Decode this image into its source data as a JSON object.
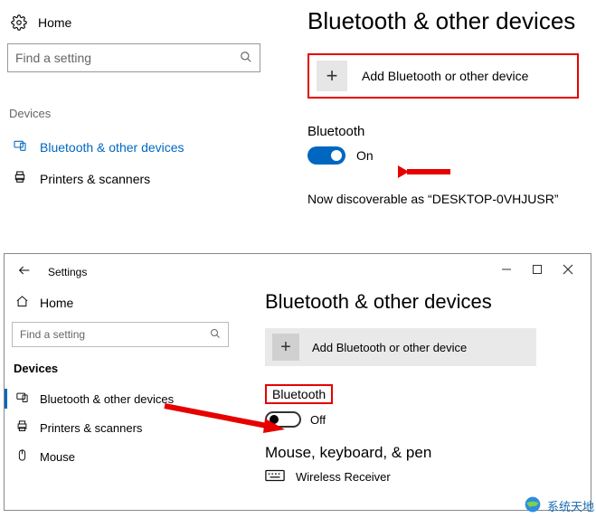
{
  "top": {
    "home_label": "Home",
    "search_placeholder": "Find a setting",
    "section_label": "Devices",
    "nav": [
      {
        "label": "Bluetooth & other devices",
        "selected": true
      },
      {
        "label": "Printers & scanners",
        "selected": false
      }
    ],
    "title": "Bluetooth & other devices",
    "add_label": "Add Bluetooth or other device",
    "plus_glyph": "+",
    "bt_heading": "Bluetooth",
    "toggle_state": "On",
    "discoverable": "Now discoverable as “DESKTOP-0VHJUSR”"
  },
  "bottom": {
    "window_title": "Settings",
    "home_label": "Home",
    "search_placeholder": "Find a setting",
    "section_label": "Devices",
    "nav": [
      {
        "label": "Bluetooth & other devices",
        "selected": true
      },
      {
        "label": "Printers & scanners",
        "selected": false
      },
      {
        "label": "Mouse",
        "selected": false
      }
    ],
    "title": "Bluetooth & other devices",
    "add_label": "Add Bluetooth or other device",
    "plus_glyph": "+",
    "bt_heading": "Bluetooth",
    "toggle_state": "Off",
    "category": "Mouse, keyboard, & pen",
    "device": "Wireless Receiver"
  },
  "watermark": "系统天地"
}
